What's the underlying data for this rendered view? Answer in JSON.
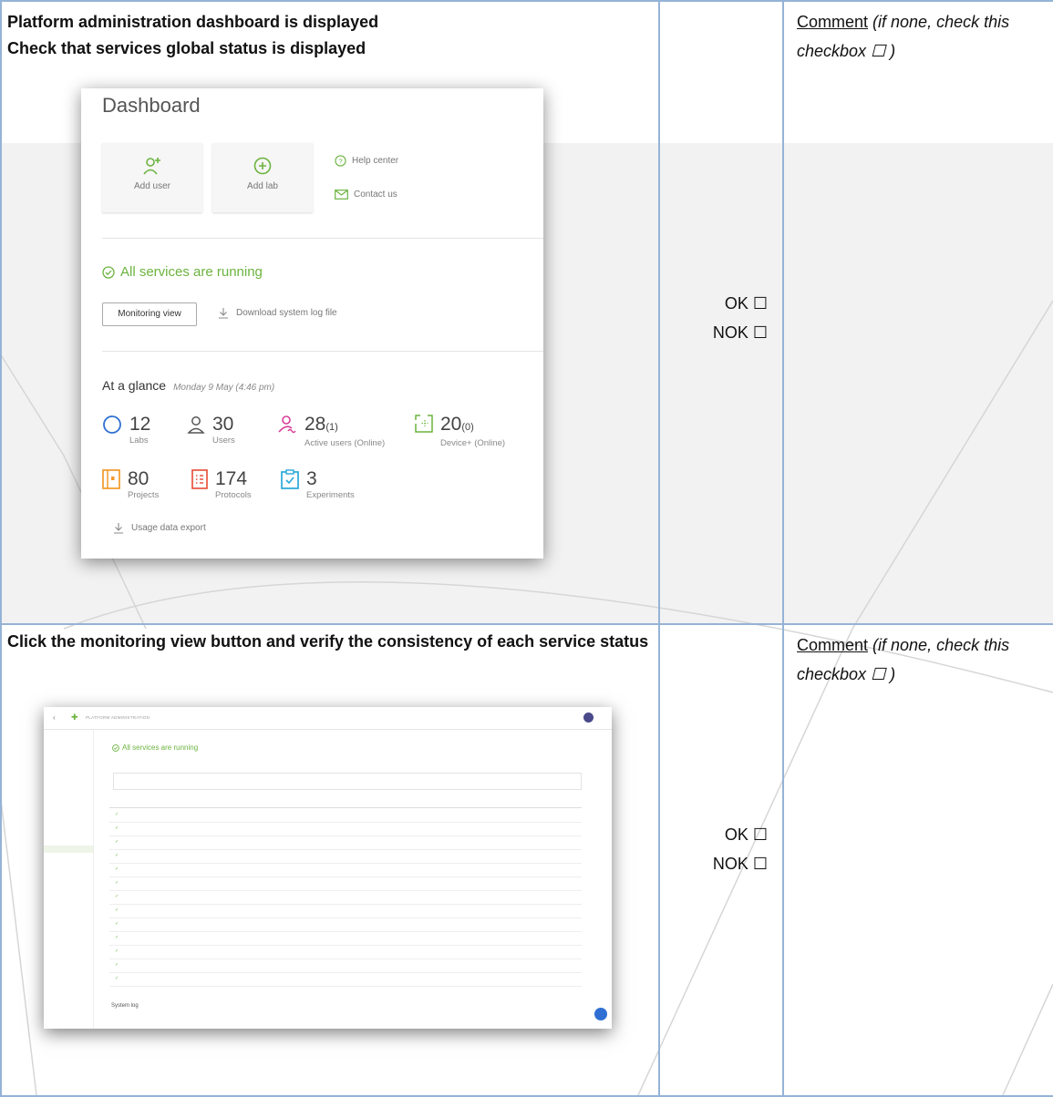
{
  "row1": {
    "title_line1": "Platform administration dashboard is displayed",
    "title_line2": "Check that services global status is displayed",
    "ok": "OK ☐",
    "nok": "NOK ☐",
    "comment_label": "Comment",
    "comment_note": " (if none, check this checkbox ☐ )"
  },
  "dashboard": {
    "title": "Dashboard",
    "add_user": "Add user",
    "add_lab": "Add lab",
    "help_center": "Help center",
    "contact_us": "Contact us",
    "services_status": "All services are running",
    "monitoring_view": "Monitoring view",
    "download_log": "Download system log file",
    "at_a_glance": "At a glance",
    "glance_date": "Monday 9 May (4:46 pm)",
    "stats": {
      "labs": {
        "value": "12",
        "label": "Labs"
      },
      "users": {
        "value": "30",
        "label": "Users"
      },
      "active_users": {
        "value": "28",
        "extra": "(1)",
        "label": "Active users (Online)"
      },
      "devices": {
        "value": "20",
        "extra": "(0)",
        "label": "Device+ (Online)"
      },
      "projects": {
        "value": "80",
        "label": "Projects"
      },
      "protocols": {
        "value": "174",
        "label": "Protocols"
      },
      "experiments": {
        "value": "3",
        "label": "Experiments"
      }
    },
    "usage_export": "Usage data export",
    "colors": {
      "green": "#6cb33f",
      "blue": "#2f6fd3",
      "magenta": "#d63f9a",
      "orange": "#f39a2b",
      "red": "#e9553f",
      "teal": "#29a9d9"
    }
  },
  "row2": {
    "title": "Click the monitoring view button and verify the consistency of each service status",
    "ok": "OK ☐",
    "nok": "NOK ☐",
    "comment_label": "Comment",
    "comment_note": " (if none, check this checkbox ☐ )"
  },
  "monitoring": {
    "app_title": "PLATFORM ADMINISTRATION",
    "status": "All services are running",
    "system_log": "System log"
  }
}
